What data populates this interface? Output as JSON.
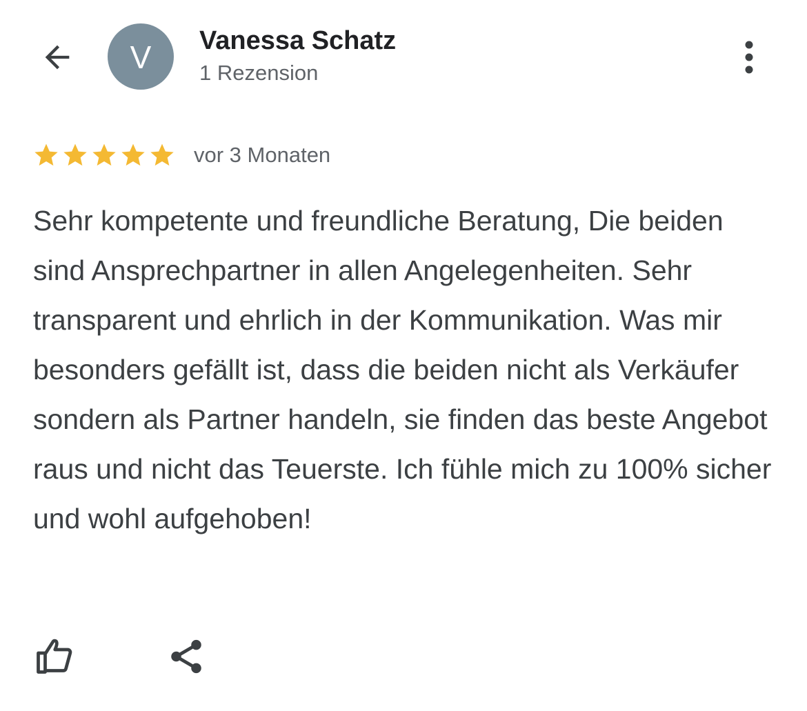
{
  "header": {
    "back_icon": "arrow-back-icon",
    "reviewer": {
      "avatar_letter": "V",
      "avatar_color": "#7b8f9c",
      "name": "Vanessa Schatz",
      "review_count": "1 Rezension"
    },
    "more_icon": "more-vert-icon"
  },
  "review": {
    "rating": 5,
    "max_rating": 5,
    "star_color": "#f4b933",
    "date": "vor 3 Monaten",
    "text": "Sehr kompetente und freundliche Beratung, Die beiden sind Ansprechpartner in allen Angelegenheiten. Sehr transparent und ehrlich in der Kommunikation. Was mir besonders gefällt ist, dass die beiden nicht als Verkäufer sondern als Partner handeln, sie finden das beste Angebot raus und nicht das Teuerste. Ich fühle mich zu 100% sicher und wohl aufgehoben!"
  },
  "actions": {
    "like_icon": "thumbs-up-icon",
    "share_icon": "share-icon"
  }
}
